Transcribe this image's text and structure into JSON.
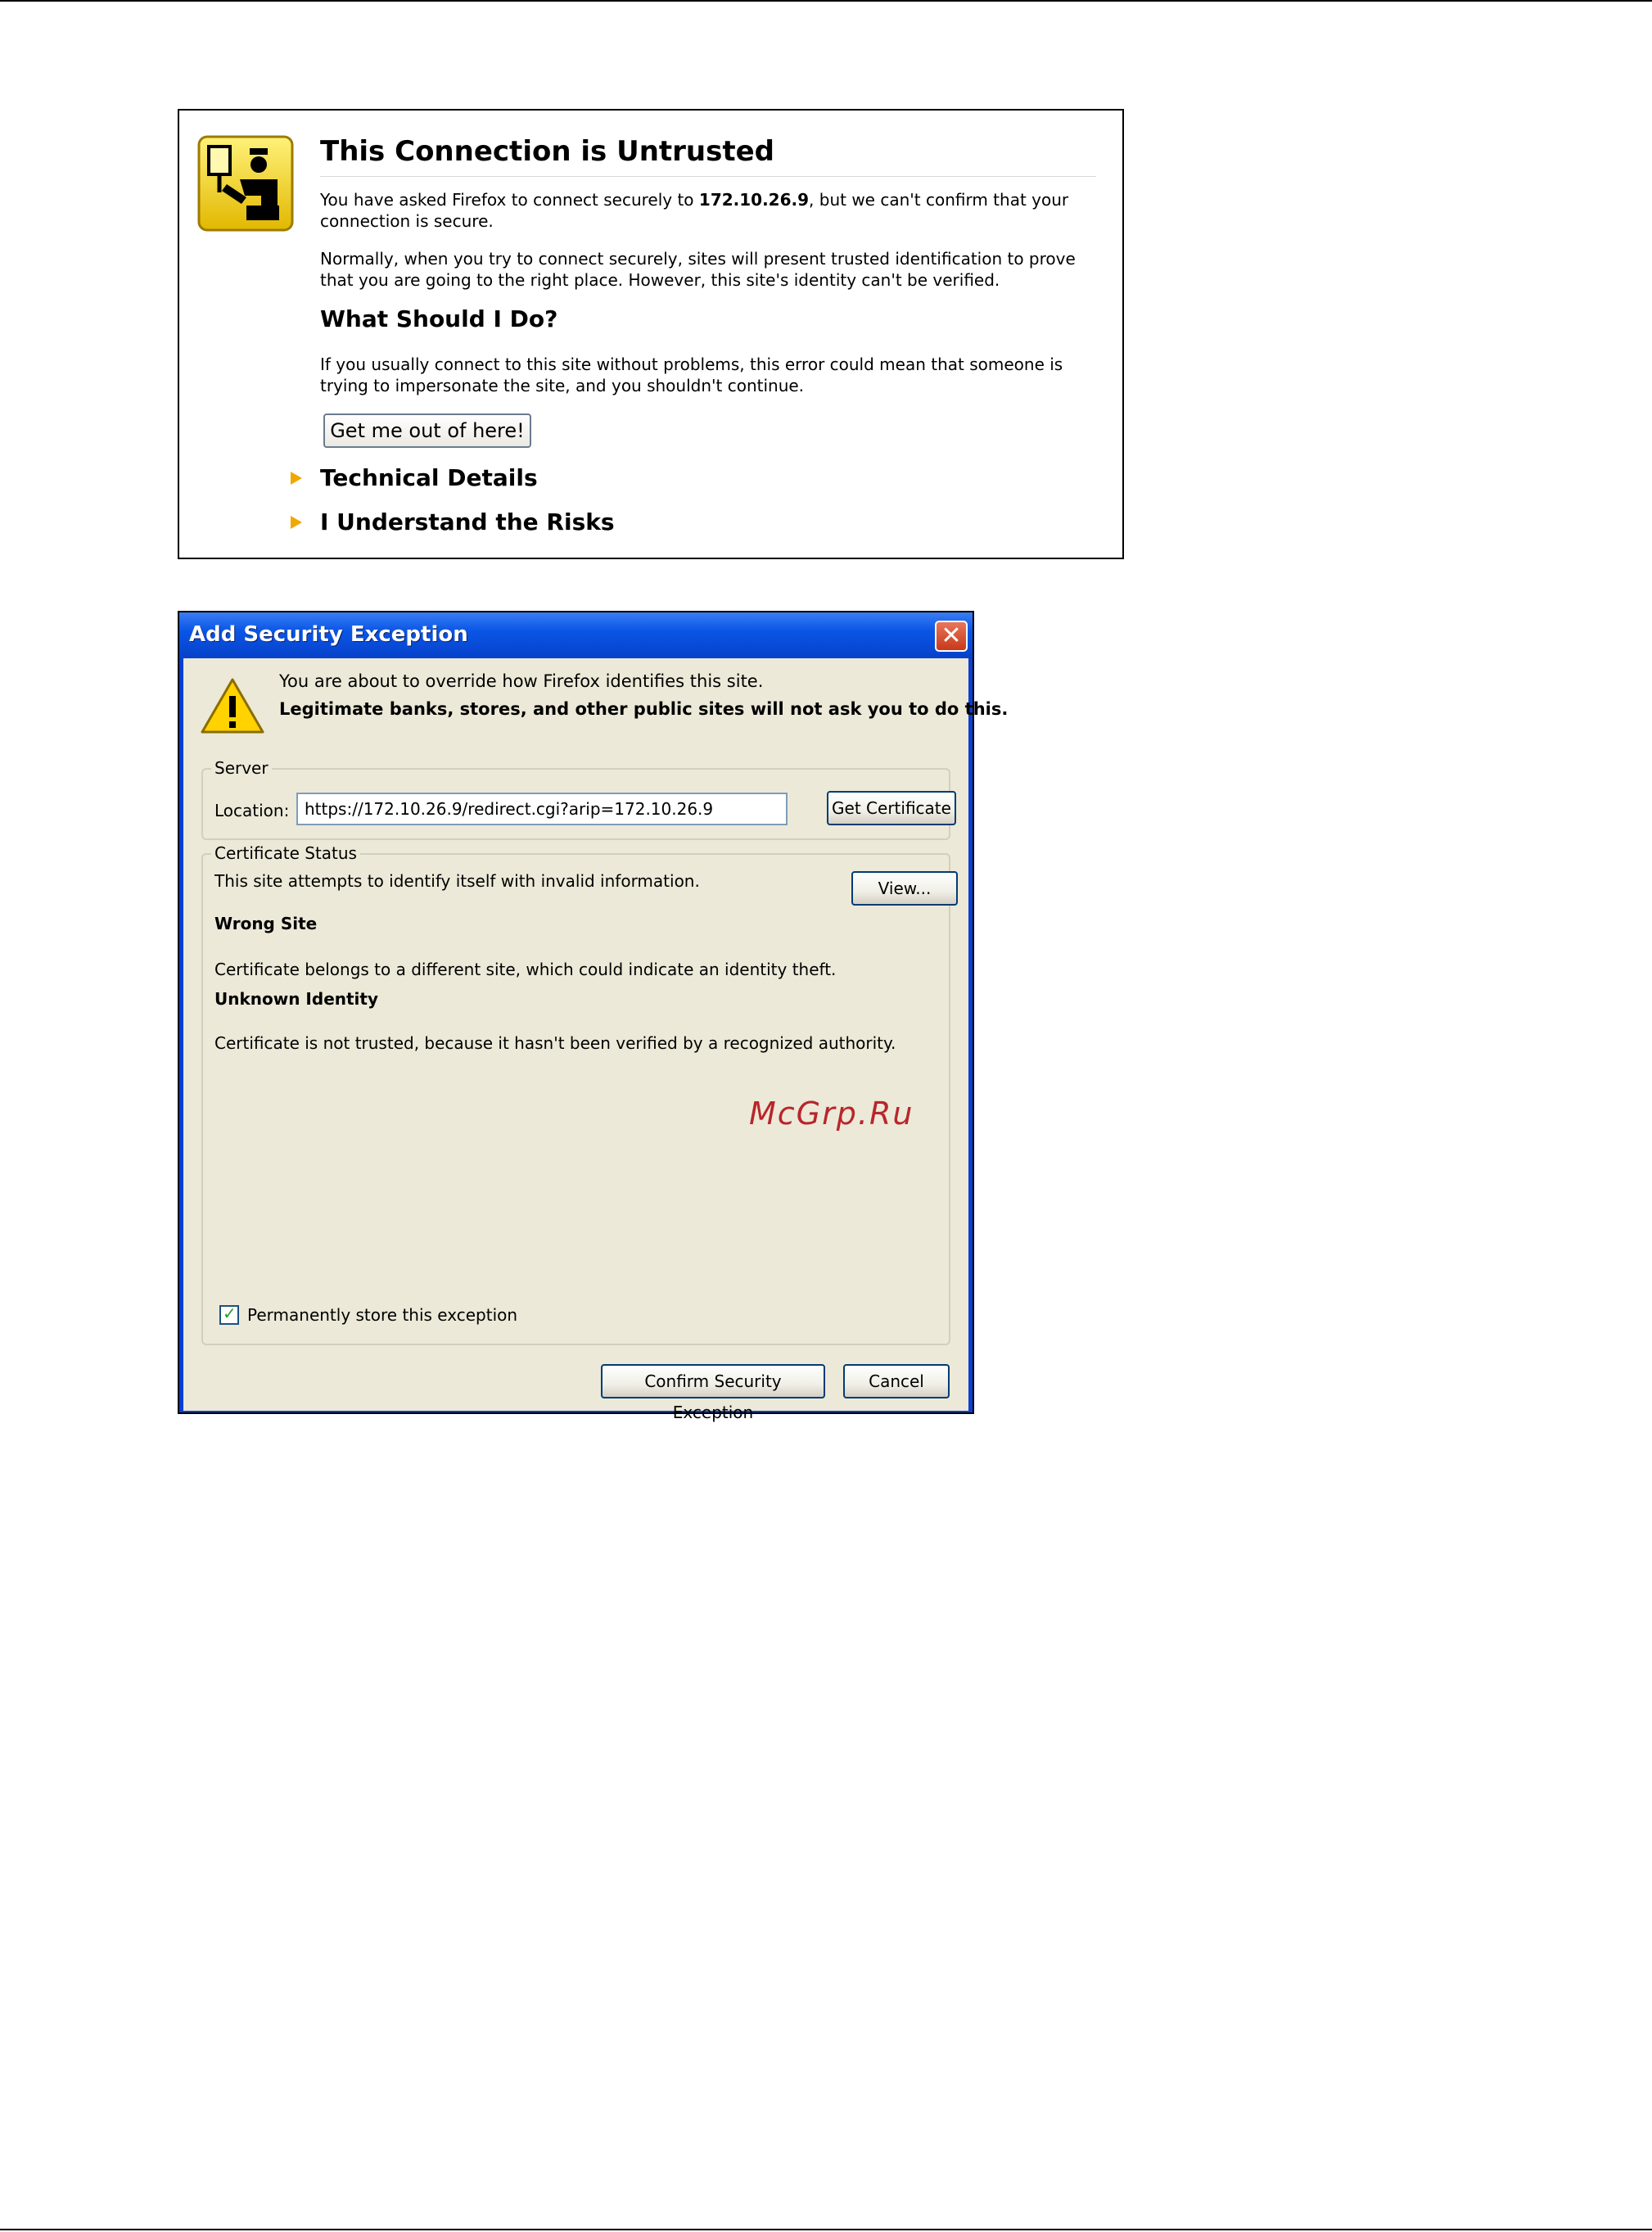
{
  "untrusted_page": {
    "title": "This Connection is Untrusted",
    "para1_before": "You have asked Firefox to connect securely to ",
    "para1_host": "172.10.26.9",
    "para1_after": ", but we can't confirm that your connection is secure.",
    "para2": "Normally, when you try to connect securely, sites will present trusted identification to prove that you are going to the right place. However, this site's identity can't be verified.",
    "heading2": "What Should I Do?",
    "para3": "If you usually connect to this site without problems, this error could mean that someone is trying to impersonate the site, and you shouldn't continue.",
    "get_out_label": "Get me out of here!",
    "technical_details_label": "Technical Details",
    "understand_risks_label": "I Understand the Risks"
  },
  "dialog": {
    "title": "Add Security Exception",
    "close_label": "✕",
    "warning_line1": "You are about to override how Firefox identifies this site.",
    "warning_line2": "Legitimate banks, stores, and other public sites will not ask you to do this.",
    "server_legend": "Server",
    "location_label": "Location:",
    "location_value": "https://172.10.26.9/redirect.cgi?arip=172.10.26.9",
    "get_certificate_label": "Get Certificate",
    "status_legend": "Certificate Status",
    "status_line": "This site attempts to identify itself with invalid information.",
    "view_label": "View...",
    "wrong_site_heading": "Wrong Site",
    "wrong_site_text": "Certificate belongs to a different site, which could indicate an identity theft.",
    "unknown_identity_heading": "Unknown Identity",
    "unknown_identity_text": "Certificate is not trusted, because it hasn't been verified by a recognized authority.",
    "permanent_label": "Permanently store this exception",
    "permanent_checked": true,
    "confirm_label": "Confirm Security Exception",
    "cancel_label": "Cancel"
  },
  "watermark": "McGrp.Ru",
  "colors": {
    "titlebar": "#0a56e6",
    "dialog_bg": "#ece9d8",
    "expander_arrow": "#f0a800",
    "watermark": "#b8262b"
  }
}
